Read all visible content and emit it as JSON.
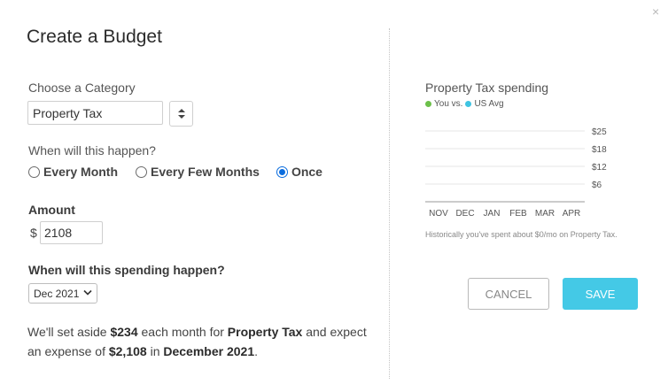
{
  "dialog": {
    "title": "Create a Budget",
    "close_glyph": "×"
  },
  "category": {
    "label": "Choose a Category",
    "value": "Property Tax"
  },
  "frequency": {
    "label": "When will this happen?",
    "options": [
      "Every Month",
      "Every Few Months",
      "Once"
    ],
    "selected": "Once"
  },
  "amount": {
    "label": "Amount",
    "currency": "$",
    "value": "2108"
  },
  "spending_date": {
    "label": "When will this spending happen?",
    "selected": "Dec 2021"
  },
  "summary": {
    "p1": "We'll set aside ",
    "monthly": "$234",
    "p2": " each month for ",
    "category": "Property Tax",
    "p3": " and expect an expense of ",
    "total": "$2,108",
    "p4": " in ",
    "date": "December 2021",
    "p5": "."
  },
  "chart_panel": {
    "title": "Property Tax spending",
    "legend_you": "You vs.",
    "legend_avg": "US Avg",
    "note": "Historically you've spent about $0/mo on Property Tax."
  },
  "colors": {
    "you": "#6cc04a",
    "us_avg": "#3fc4e2",
    "save": "#44c9e6",
    "radio": "#0a6cde"
  },
  "chart_data": {
    "type": "bar",
    "categories": [
      "NOV",
      "DEC",
      "JAN",
      "FEB",
      "MAR",
      "APR"
    ],
    "y_ticks": [
      "$25",
      "$18",
      "$12",
      "$6"
    ],
    "series": [
      {
        "name": "You",
        "values": [
          0,
          0,
          0,
          0,
          0,
          0
        ]
      },
      {
        "name": "US Avg",
        "values": [
          0,
          0,
          0,
          0,
          0,
          0
        ]
      }
    ],
    "ylim": [
      0,
      25
    ],
    "grid": true
  },
  "buttons": {
    "cancel": "CANCEL",
    "save": "SAVE"
  }
}
